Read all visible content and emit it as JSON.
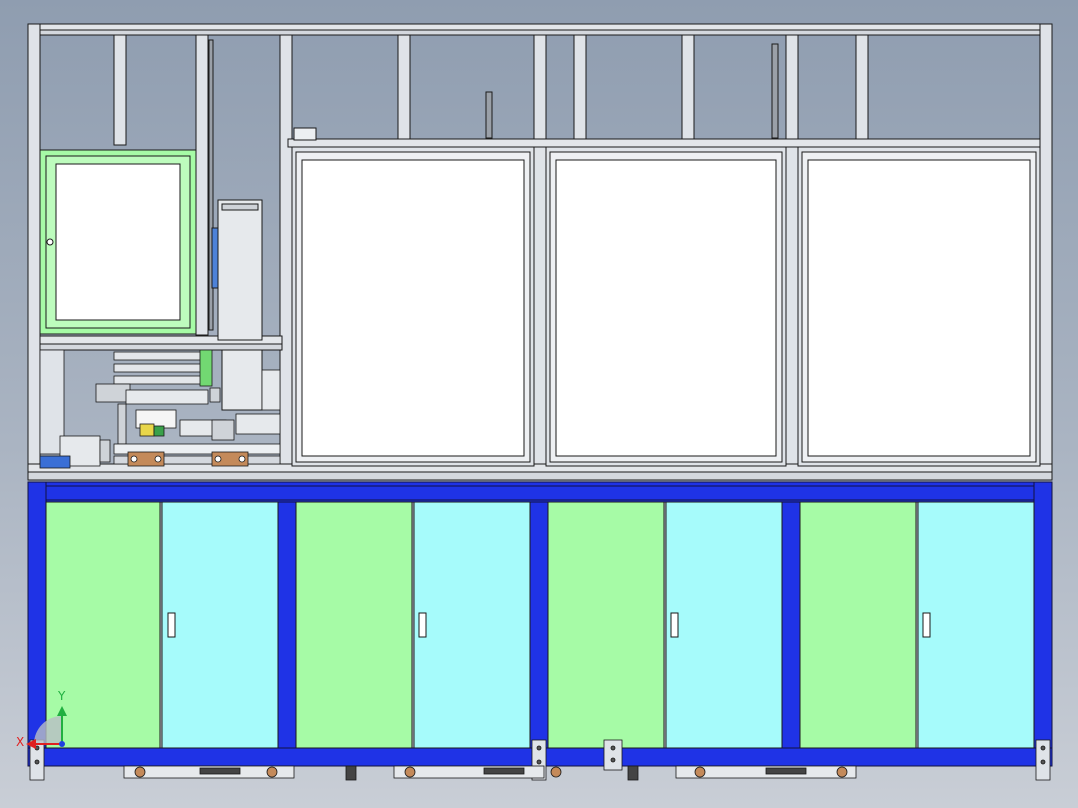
{
  "scene": {
    "title": "",
    "description_visible": false
  },
  "triad": {
    "x_label": "X",
    "y_label": "Y",
    "x_color": "#e02020",
    "y_color": "#20b040",
    "z_color": "#2040e0"
  },
  "colors": {
    "background_top": "#8f9db0",
    "background_bottom": "#c9ced6",
    "frame_blue": "#1f33e6",
    "door_green": "#a6fba6",
    "door_cyan": "#a6fbfb",
    "aluminum": "#dfe3e8",
    "edge": "#1a1a1a"
  },
  "cabinet": {
    "bays": 4,
    "doors_per_bay": 2,
    "upper_panels": 3
  }
}
